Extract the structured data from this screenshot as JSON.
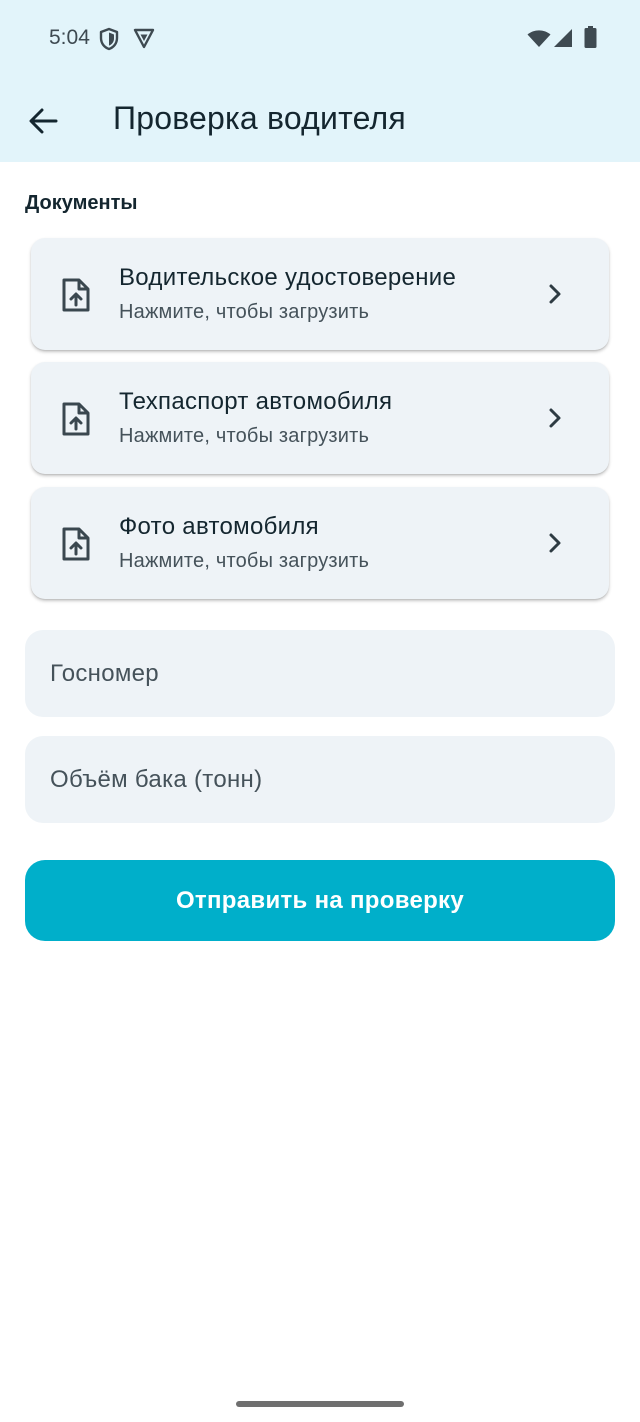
{
  "status_bar": {
    "time": "5:04",
    "left_icons": [
      "shield-icon",
      "vpn-icon"
    ],
    "right_icons": [
      "wifi-icon",
      "signal-icon",
      "battery-icon"
    ]
  },
  "app_bar": {
    "back_icon": "arrow-back-icon",
    "title": "Проверка водителя"
  },
  "documents_section": {
    "label": "Документы",
    "items": [
      {
        "title": "Водительское удостоверение",
        "subtitle": "Нажмите, чтобы загрузить",
        "icon": "file-upload-icon"
      },
      {
        "title": "Техпаспорт автомобиля",
        "subtitle": "Нажмите, чтобы загрузить",
        "icon": "file-upload-icon"
      },
      {
        "title": "Фото автомобиля",
        "subtitle": "Нажмите, чтобы загрузить",
        "icon": "file-upload-icon"
      }
    ]
  },
  "form": {
    "plate": {
      "placeholder": "Госномер",
      "value": ""
    },
    "tank": {
      "placeholder": "Объём бака (тонн)",
      "value": ""
    }
  },
  "submit_label": "Отправить на проверку",
  "colors": {
    "header_bg": "#e2f4fa",
    "card_bg": "#eef3f7",
    "accent": "#00afca",
    "text_primary": "#14262f",
    "text_secondary": "#45525a"
  }
}
